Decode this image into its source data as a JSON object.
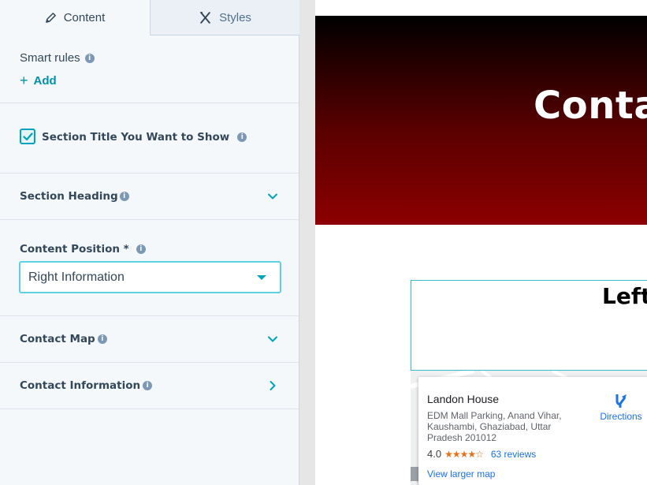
{
  "tabs": [
    {
      "label": "Content",
      "icon": "pencil-icon",
      "active": true
    },
    {
      "label": "Styles",
      "icon": "brush-icon",
      "active": false
    }
  ],
  "smart_rules": {
    "label": "Smart rules",
    "add_label": "Add"
  },
  "section_title": {
    "label": "Section Title You Want to Show",
    "checked": true
  },
  "section_heading": {
    "label": "Section Heading"
  },
  "content_position": {
    "label": "Content Position *",
    "selected": "Right Information"
  },
  "contact_map": {
    "label": "Contact Map"
  },
  "contact_information": {
    "label": "Contact Information"
  },
  "preview": {
    "hero_title": "Conta",
    "left_title": "Left",
    "map_card": {
      "name": "Landon House",
      "address": "EDM Mall Parking, Anand Vihar, Kaushambi, Ghaziabad, Uttar Pradesh 201012",
      "rating": "4.0",
      "stars": "★★★★☆",
      "reviews": "63 reviews",
      "larger_map": "View larger map",
      "directions": "Directions"
    }
  },
  "colors": {
    "accent": "#00a4bd",
    "link": "#1a73e8",
    "hero_bottom": "#8c0000"
  }
}
